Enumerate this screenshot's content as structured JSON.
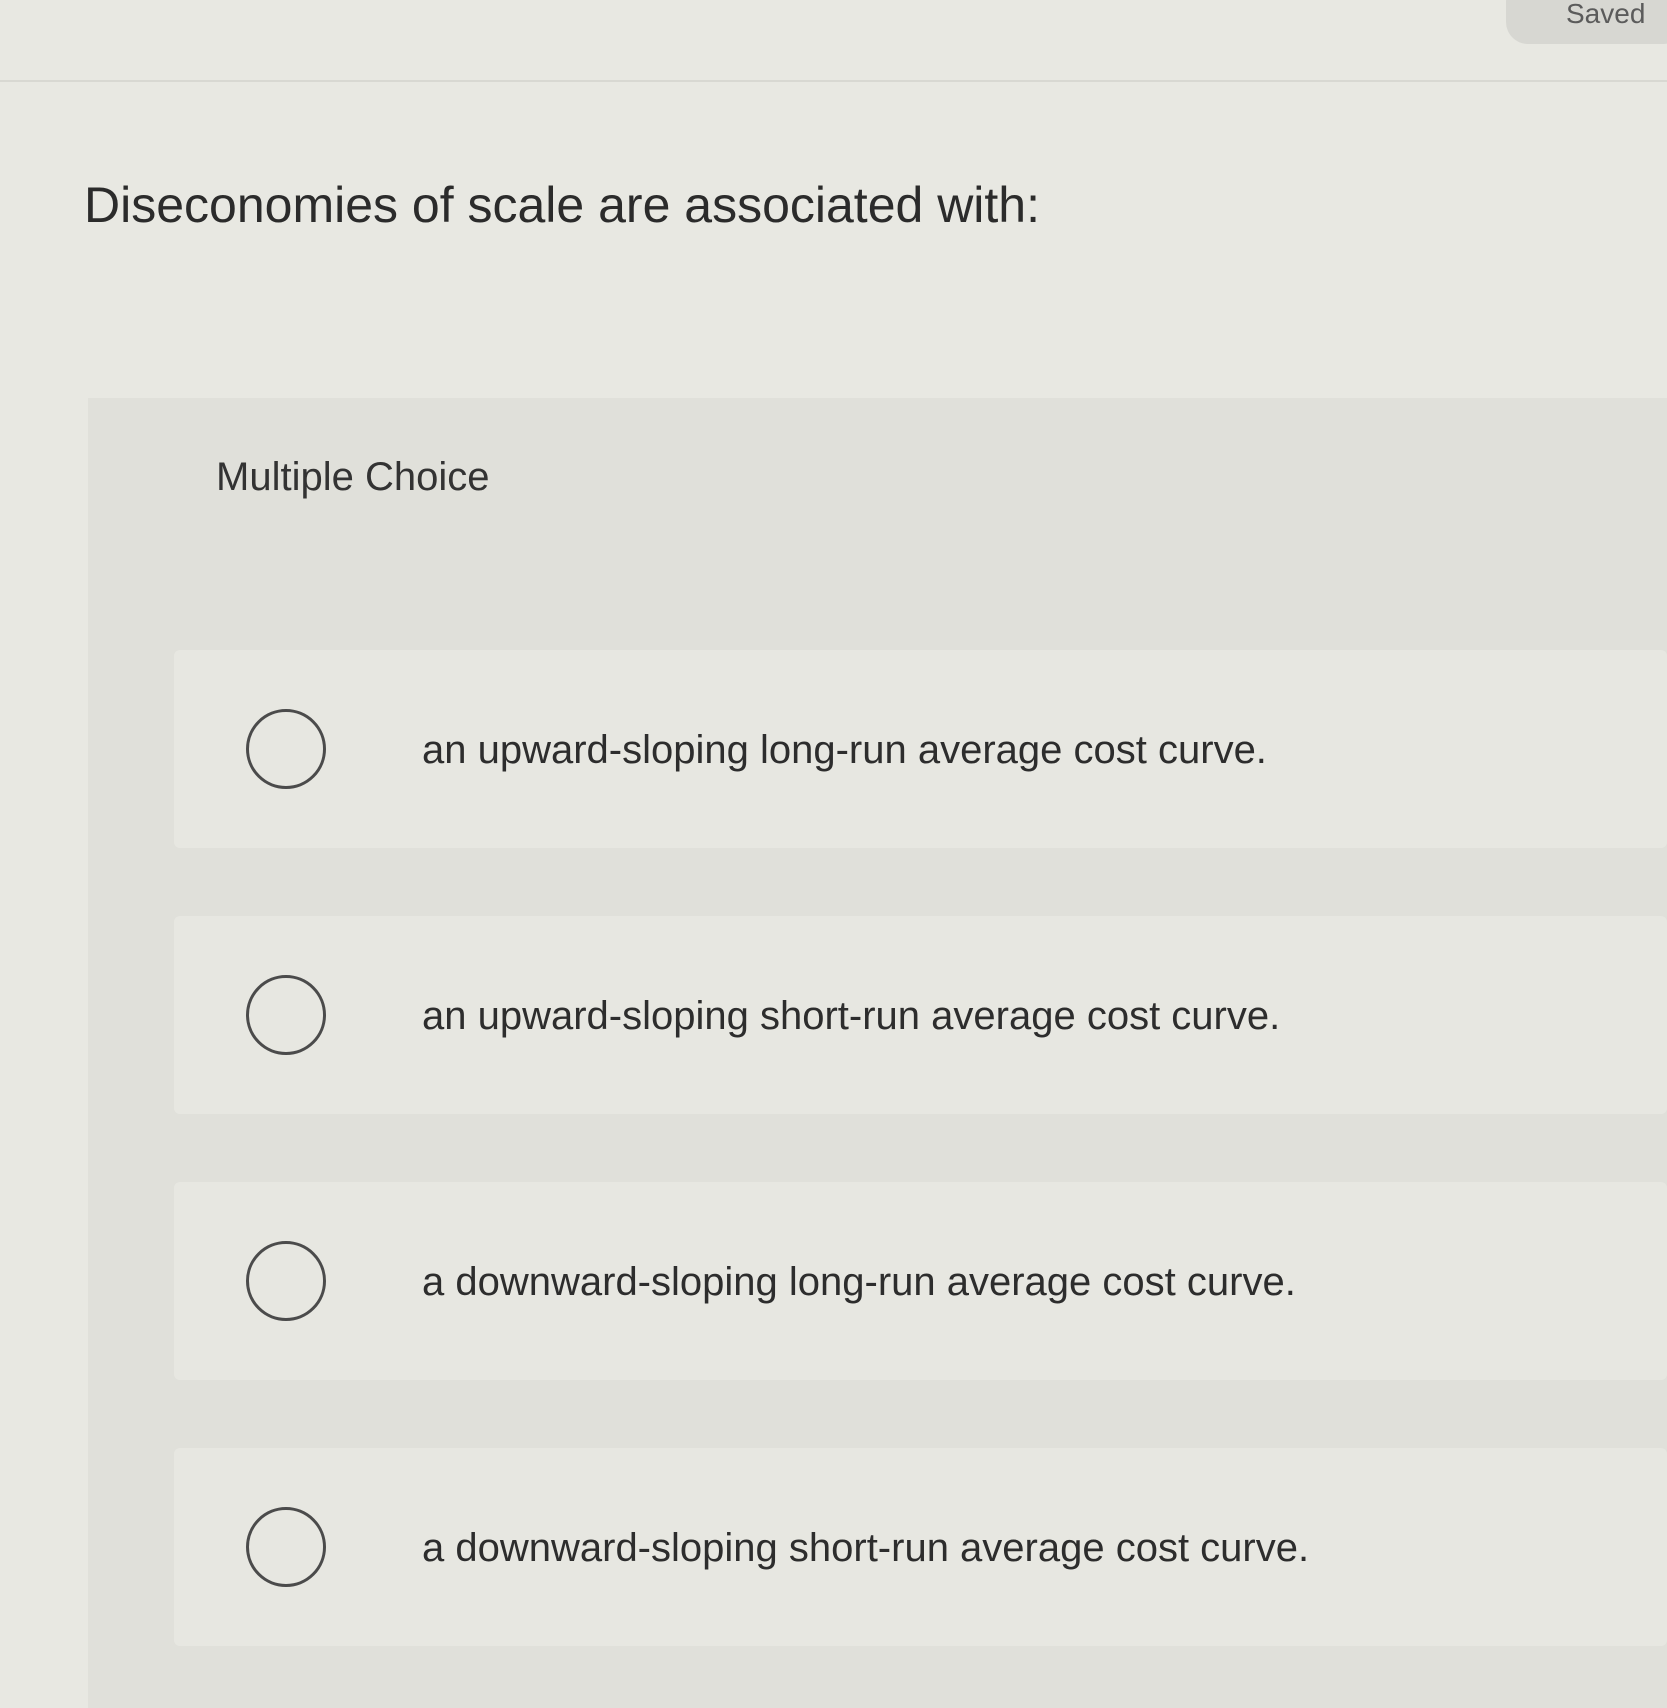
{
  "status": {
    "saved_label": "Saved"
  },
  "question": {
    "text": "Diseconomies of scale are associated with:"
  },
  "multiple_choice": {
    "label": "Multiple Choice",
    "options": [
      {
        "text": "an upward-sloping long-run average cost curve."
      },
      {
        "text": "an upward-sloping short-run average cost curve."
      },
      {
        "text": "a downward-sloping long-run average cost curve."
      },
      {
        "text": "a downward-sloping short-run average cost curve."
      }
    ]
  }
}
